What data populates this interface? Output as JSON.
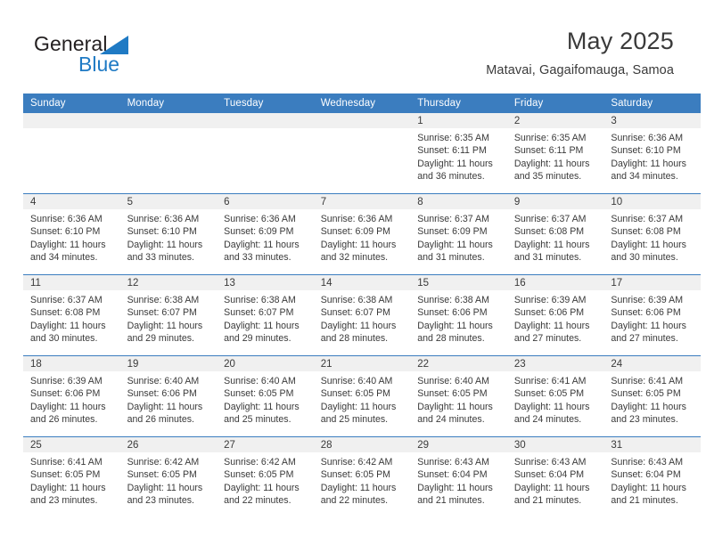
{
  "brand": {
    "name_top": "General",
    "name_bottom": "Blue",
    "triangle_color": "#1f7ac4",
    "text_color": "#231f20",
    "blue_color": "#1f7ac4"
  },
  "header": {
    "title": "May 2025",
    "subtitle": "Matavai, Gagaifomauga, Samoa"
  },
  "theme": {
    "header_bg": "#3b7dbf",
    "header_text": "#ffffff",
    "daynum_band_bg": "#f0f0f0",
    "cell_bg": "#ffffff",
    "row_border": "#3b7dbf",
    "body_text": "#3a3a3a"
  },
  "weekday_headers": [
    "Sunday",
    "Monday",
    "Tuesday",
    "Wednesday",
    "Thursday",
    "Friday",
    "Saturday"
  ],
  "weeks": [
    [
      {
        "day": "",
        "lines": []
      },
      {
        "day": "",
        "lines": []
      },
      {
        "day": "",
        "lines": []
      },
      {
        "day": "",
        "lines": []
      },
      {
        "day": "1",
        "lines": [
          "Sunrise: 6:35 AM",
          "Sunset: 6:11 PM",
          "Daylight: 11 hours",
          "and 36 minutes."
        ]
      },
      {
        "day": "2",
        "lines": [
          "Sunrise: 6:35 AM",
          "Sunset: 6:11 PM",
          "Daylight: 11 hours",
          "and 35 minutes."
        ]
      },
      {
        "day": "3",
        "lines": [
          "Sunrise: 6:36 AM",
          "Sunset: 6:10 PM",
          "Daylight: 11 hours",
          "and 34 minutes."
        ]
      }
    ],
    [
      {
        "day": "4",
        "lines": [
          "Sunrise: 6:36 AM",
          "Sunset: 6:10 PM",
          "Daylight: 11 hours",
          "and 34 minutes."
        ]
      },
      {
        "day": "5",
        "lines": [
          "Sunrise: 6:36 AM",
          "Sunset: 6:10 PM",
          "Daylight: 11 hours",
          "and 33 minutes."
        ]
      },
      {
        "day": "6",
        "lines": [
          "Sunrise: 6:36 AM",
          "Sunset: 6:09 PM",
          "Daylight: 11 hours",
          "and 33 minutes."
        ]
      },
      {
        "day": "7",
        "lines": [
          "Sunrise: 6:36 AM",
          "Sunset: 6:09 PM",
          "Daylight: 11 hours",
          "and 32 minutes."
        ]
      },
      {
        "day": "8",
        "lines": [
          "Sunrise: 6:37 AM",
          "Sunset: 6:09 PM",
          "Daylight: 11 hours",
          "and 31 minutes."
        ]
      },
      {
        "day": "9",
        "lines": [
          "Sunrise: 6:37 AM",
          "Sunset: 6:08 PM",
          "Daylight: 11 hours",
          "and 31 minutes."
        ]
      },
      {
        "day": "10",
        "lines": [
          "Sunrise: 6:37 AM",
          "Sunset: 6:08 PM",
          "Daylight: 11 hours",
          "and 30 minutes."
        ]
      }
    ],
    [
      {
        "day": "11",
        "lines": [
          "Sunrise: 6:37 AM",
          "Sunset: 6:08 PM",
          "Daylight: 11 hours",
          "and 30 minutes."
        ]
      },
      {
        "day": "12",
        "lines": [
          "Sunrise: 6:38 AM",
          "Sunset: 6:07 PM",
          "Daylight: 11 hours",
          "and 29 minutes."
        ]
      },
      {
        "day": "13",
        "lines": [
          "Sunrise: 6:38 AM",
          "Sunset: 6:07 PM",
          "Daylight: 11 hours",
          "and 29 minutes."
        ]
      },
      {
        "day": "14",
        "lines": [
          "Sunrise: 6:38 AM",
          "Sunset: 6:07 PM",
          "Daylight: 11 hours",
          "and 28 minutes."
        ]
      },
      {
        "day": "15",
        "lines": [
          "Sunrise: 6:38 AM",
          "Sunset: 6:06 PM",
          "Daylight: 11 hours",
          "and 28 minutes."
        ]
      },
      {
        "day": "16",
        "lines": [
          "Sunrise: 6:39 AM",
          "Sunset: 6:06 PM",
          "Daylight: 11 hours",
          "and 27 minutes."
        ]
      },
      {
        "day": "17",
        "lines": [
          "Sunrise: 6:39 AM",
          "Sunset: 6:06 PM",
          "Daylight: 11 hours",
          "and 27 minutes."
        ]
      }
    ],
    [
      {
        "day": "18",
        "lines": [
          "Sunrise: 6:39 AM",
          "Sunset: 6:06 PM",
          "Daylight: 11 hours",
          "and 26 minutes."
        ]
      },
      {
        "day": "19",
        "lines": [
          "Sunrise: 6:40 AM",
          "Sunset: 6:06 PM",
          "Daylight: 11 hours",
          "and 26 minutes."
        ]
      },
      {
        "day": "20",
        "lines": [
          "Sunrise: 6:40 AM",
          "Sunset: 6:05 PM",
          "Daylight: 11 hours",
          "and 25 minutes."
        ]
      },
      {
        "day": "21",
        "lines": [
          "Sunrise: 6:40 AM",
          "Sunset: 6:05 PM",
          "Daylight: 11 hours",
          "and 25 minutes."
        ]
      },
      {
        "day": "22",
        "lines": [
          "Sunrise: 6:40 AM",
          "Sunset: 6:05 PM",
          "Daylight: 11 hours",
          "and 24 minutes."
        ]
      },
      {
        "day": "23",
        "lines": [
          "Sunrise: 6:41 AM",
          "Sunset: 6:05 PM",
          "Daylight: 11 hours",
          "and 24 minutes."
        ]
      },
      {
        "day": "24",
        "lines": [
          "Sunrise: 6:41 AM",
          "Sunset: 6:05 PM",
          "Daylight: 11 hours",
          "and 23 minutes."
        ]
      }
    ],
    [
      {
        "day": "25",
        "lines": [
          "Sunrise: 6:41 AM",
          "Sunset: 6:05 PM",
          "Daylight: 11 hours",
          "and 23 minutes."
        ]
      },
      {
        "day": "26",
        "lines": [
          "Sunrise: 6:42 AM",
          "Sunset: 6:05 PM",
          "Daylight: 11 hours",
          "and 23 minutes."
        ]
      },
      {
        "day": "27",
        "lines": [
          "Sunrise: 6:42 AM",
          "Sunset: 6:05 PM",
          "Daylight: 11 hours",
          "and 22 minutes."
        ]
      },
      {
        "day": "28",
        "lines": [
          "Sunrise: 6:42 AM",
          "Sunset: 6:05 PM",
          "Daylight: 11 hours",
          "and 22 minutes."
        ]
      },
      {
        "day": "29",
        "lines": [
          "Sunrise: 6:43 AM",
          "Sunset: 6:04 PM",
          "Daylight: 11 hours",
          "and 21 minutes."
        ]
      },
      {
        "day": "30",
        "lines": [
          "Sunrise: 6:43 AM",
          "Sunset: 6:04 PM",
          "Daylight: 11 hours",
          "and 21 minutes."
        ]
      },
      {
        "day": "31",
        "lines": [
          "Sunrise: 6:43 AM",
          "Sunset: 6:04 PM",
          "Daylight: 11 hours",
          "and 21 minutes."
        ]
      }
    ]
  ]
}
